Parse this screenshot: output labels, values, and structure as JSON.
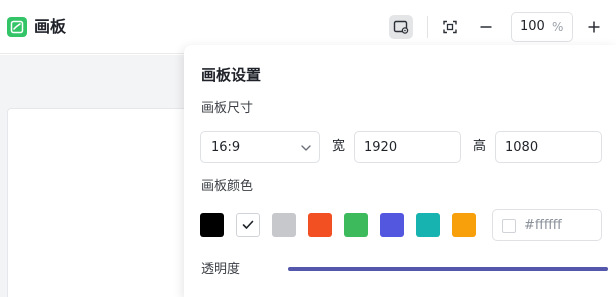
{
  "app": {
    "title": "画板",
    "logo_icon": "canvas-app-icon",
    "brand_color": "#33c467"
  },
  "toolbar": {
    "zoom_value": "100",
    "zoom_unit": "%",
    "buttons": [
      "canvas-settings-icon",
      "fit-screen-icon",
      "zoom-out-icon",
      "zoom-in-icon"
    ]
  },
  "panel": {
    "title": "画板设置",
    "size": {
      "label": "画板尺寸",
      "ratio": "16:9",
      "width_label": "宽",
      "width_value": "1920",
      "height_label": "高",
      "height_value": "1080"
    },
    "color": {
      "label": "画板颜色",
      "swatches": [
        "#000000",
        "#ffffff",
        "#c6c8cc",
        "#f25022",
        "#3dbb5c",
        "#5357e0",
        "#16b3b0",
        "#f7a00c"
      ],
      "selected": "#ffffff",
      "hex_value": "#ffffff"
    },
    "opacity": {
      "label": "透明度",
      "value": 1.0,
      "accent": "#5457ac"
    }
  }
}
